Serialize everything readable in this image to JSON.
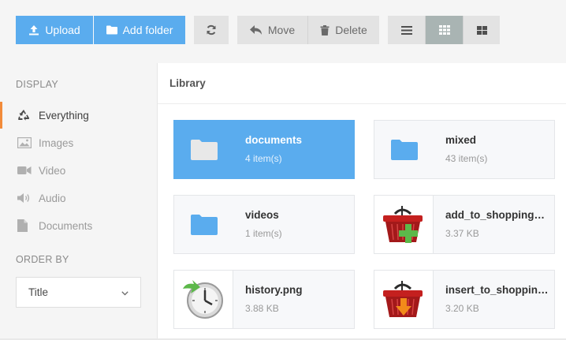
{
  "toolbar": {
    "upload_label": "Upload",
    "add_folder_label": "Add folder",
    "refresh_icon": "refresh-icon",
    "move_label": "Move",
    "delete_label": "Delete",
    "view_modes": [
      "list-view-icon",
      "grid-view-icon",
      "large-grid-view-icon"
    ],
    "active_view": "grid-view-icon"
  },
  "sidebar": {
    "display_heading": "DISPLAY",
    "filters": [
      {
        "label": "Everything",
        "icon": "recycle-icon",
        "active": true
      },
      {
        "label": "Images",
        "icon": "image-icon",
        "active": false
      },
      {
        "label": "Video",
        "icon": "video-icon",
        "active": false
      },
      {
        "label": "Audio",
        "icon": "audio-icon",
        "active": false
      },
      {
        "label": "Documents",
        "icon": "document-icon",
        "active": false
      }
    ],
    "order_heading": "ORDER BY",
    "order_value": "Title"
  },
  "main": {
    "title": "Library",
    "items": [
      {
        "name": "documents",
        "meta": "4 item(s)",
        "type": "folder",
        "selected": true
      },
      {
        "name": "mixed",
        "meta": "43 item(s)",
        "type": "folder",
        "selected": false
      },
      {
        "name": "videos",
        "meta": "1 item(s)",
        "type": "folder",
        "selected": false
      },
      {
        "name": "add_to_shopping_cart.png",
        "meta": "3.37 KB",
        "type": "image",
        "icon": "basket-add-icon",
        "selected": false
      },
      {
        "name": "history.png",
        "meta": "3.88 KB",
        "type": "image",
        "icon": "history-clock-icon",
        "selected": false
      },
      {
        "name": "insert_to_shopping_cart.png",
        "meta": "3.20 KB",
        "type": "image",
        "icon": "basket-insert-icon",
        "selected": false
      }
    ]
  },
  "colors": {
    "accent": "#5aacee",
    "active_indicator": "#f28b3a",
    "folder_icon": "#5aacee"
  }
}
